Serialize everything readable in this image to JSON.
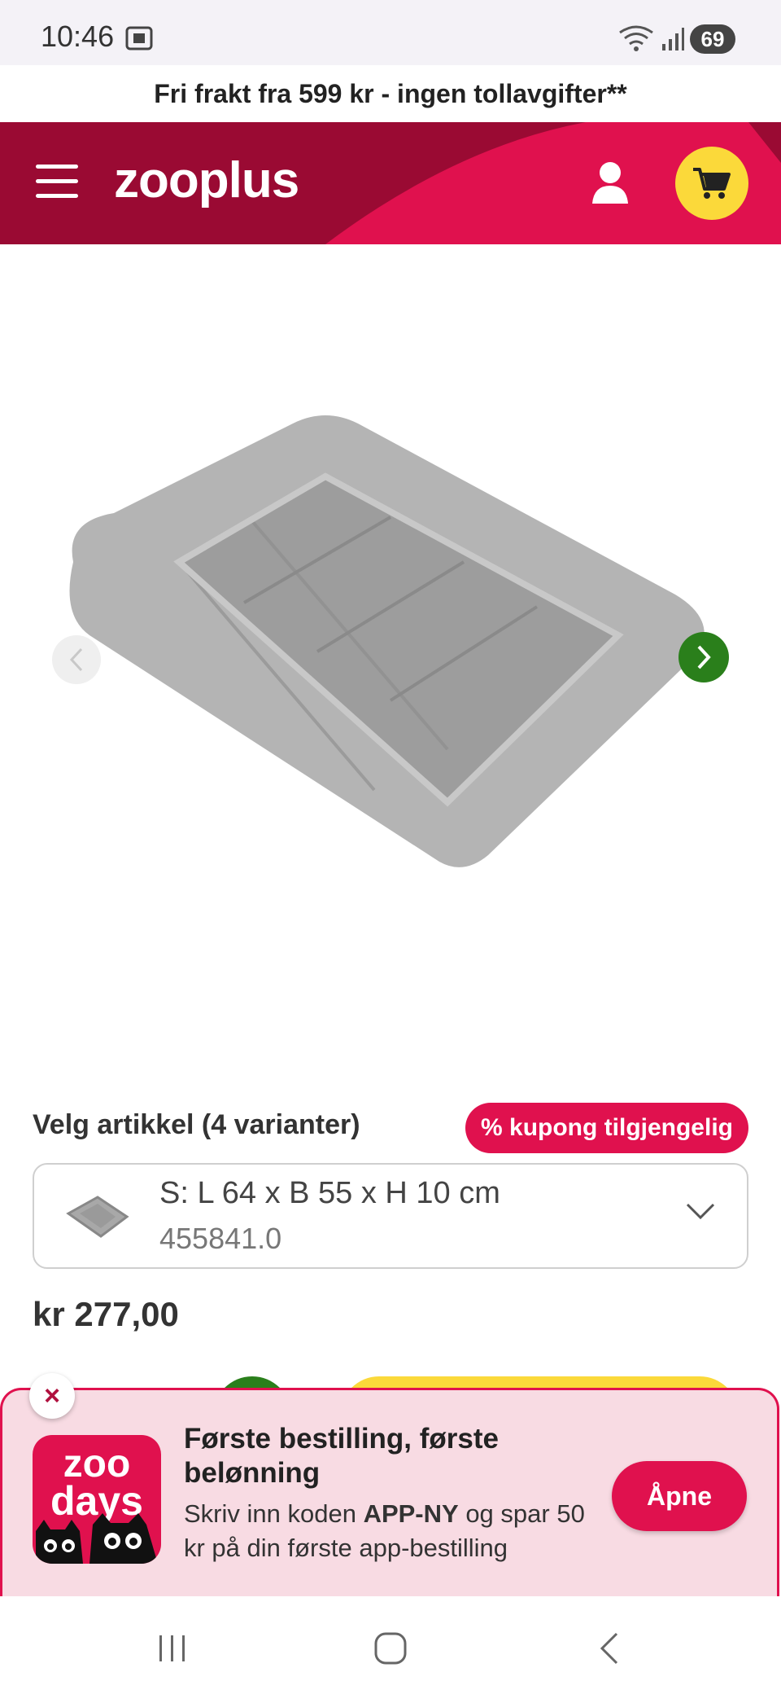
{
  "status_bar": {
    "time": "10:46",
    "battery": "69"
  },
  "promo": {
    "text": "Fri frakt fra 599 kr - ingen tollavgifter**"
  },
  "header": {
    "logo": "zooplus"
  },
  "product": {
    "variant_heading": "Velg artikkel (4 varianter)",
    "coupon_badge": "% kupong tilgjengelig",
    "variant": {
      "name": "S: L 64 x B 55 x H 10 cm",
      "sku": "455841.0"
    },
    "price": "kr 277,00"
  },
  "app_banner": {
    "logo_line1": "zoo",
    "logo_line2": "days",
    "title": "Første bestilling, første belønning",
    "text_before": "Skriv inn koden ",
    "code": "APP-NY",
    "text_after": " og spar 50 kr på din første app-bestilling",
    "open_button": "Åpne",
    "close_symbol": "×"
  },
  "colors": {
    "brand": "#e0114e",
    "brand_dark": "#9a0a33",
    "cart": "#fbd93a",
    "green": "#2a7f1b"
  }
}
